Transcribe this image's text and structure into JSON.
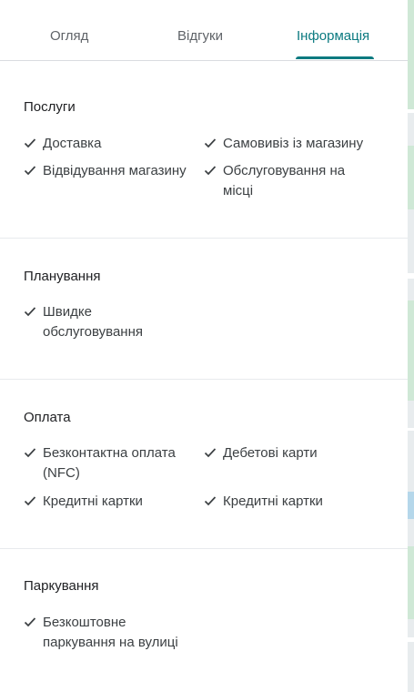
{
  "tabs": [
    {
      "label": "Огляд",
      "active": false
    },
    {
      "label": "Відгуки",
      "active": false
    },
    {
      "label": "Інформація",
      "active": true
    }
  ],
  "accent_color": "#0b7a80",
  "sections": [
    {
      "title": "Послуги",
      "items": [
        "Доставка",
        "Самовивіз із магазину",
        "Відвідування магазину",
        "Обслуговування на місці"
      ]
    },
    {
      "title": "Планування",
      "items": [
        "Швидке обслуговування"
      ]
    },
    {
      "title": "Оплата",
      "items": [
        "Безконтактна оплата (NFC)",
        "Дебетові карти",
        "Кредитні картки",
        "Кредитні картки"
      ]
    },
    {
      "title": "Паркування",
      "items": [
        "Безкоштовне паркування на вулиці"
      ]
    }
  ],
  "icons": {
    "attribute": "checkmark-icon"
  }
}
